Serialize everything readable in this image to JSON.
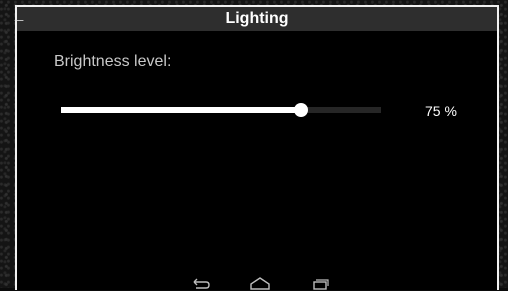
{
  "header": {
    "title": "Lighting",
    "back_icon": "back-arrow-icon"
  },
  "brightness": {
    "label": "Brightness level:",
    "level": 0.75,
    "value_text": "75 %"
  },
  "navbar": {
    "icons": [
      "back-nav-icon",
      "home-nav-icon",
      "recent-apps-icon"
    ]
  },
  "colors": {
    "titlebar": "#2e2e2e",
    "slider_fill": "#ffffff",
    "slider_track": "#262626",
    "dialog_border": "#f2f2f2"
  }
}
